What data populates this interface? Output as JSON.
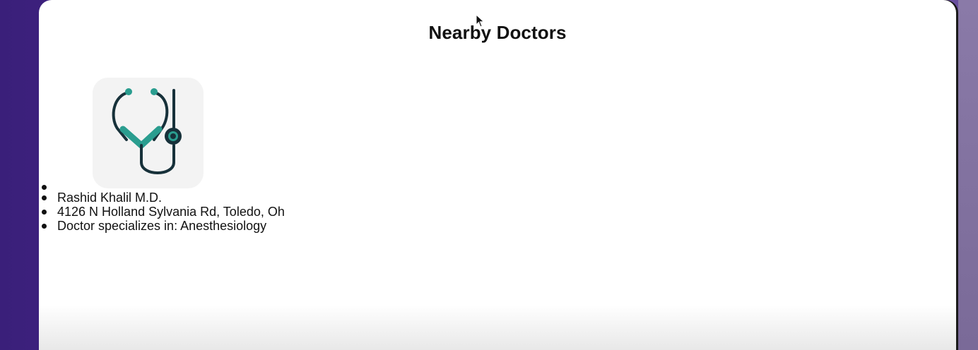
{
  "page": {
    "title": "Nearby Doctors"
  },
  "doctors": [
    {
      "image_icon": "stethoscope-icon",
      "name": "Rashid Khalil M.D.",
      "address": "4126 N Holland Sylvania Rd, Toledo, Oh",
      "specialty": "Doctor specializes in: Anesthesiology"
    }
  ],
  "colors": {
    "background_gradient_start": "#3a1f7a",
    "background_gradient_end": "#6a4f9e",
    "window": "#ffffff",
    "text": "#111111",
    "icon_tile": "#f3f3f3",
    "stethoscope_dark": "#17313a",
    "stethoscope_teal": "#2a9d8f"
  }
}
